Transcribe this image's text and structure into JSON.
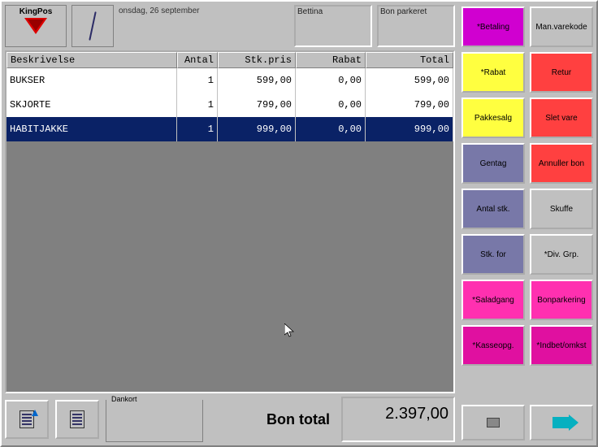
{
  "app_name": "KingPos",
  "date_text": "onsdag, 26 september",
  "info_fields": {
    "user_label": "Bettina",
    "status_label": "Bon parkeret"
  },
  "table": {
    "headers": {
      "desc": "Beskrivelse",
      "qty": "Antal",
      "price": "Stk.pris",
      "rabat": "Rabat",
      "total": "Total"
    },
    "rows": [
      {
        "desc": "BUKSER",
        "qty": "1",
        "price": "599,00",
        "rabat": "0,00",
        "total": "599,00",
        "selected": false
      },
      {
        "desc": "SKJORTE",
        "qty": "1",
        "price": "799,00",
        "rabat": "0,00",
        "total": "799,00",
        "selected": false
      },
      {
        "desc": "HABITJAKKE",
        "qty": "1",
        "price": "999,00",
        "rabat": "0,00",
        "total": "999,00",
        "selected": true
      }
    ]
  },
  "payment_group_label": "Dankort",
  "total_label": "Bon total",
  "total_value": "2.397,00",
  "buttons": {
    "row0": [
      {
        "label": "*Betaling",
        "color": "c-magenta"
      },
      {
        "label": "Man.varekode",
        "color": "c-gray"
      }
    ],
    "row1": [
      {
        "label": "*Rabat",
        "color": "c-yellow"
      },
      {
        "label": "Retur",
        "color": "c-red"
      }
    ],
    "row2": [
      {
        "label": "Pakkesalg",
        "color": "c-yellow"
      },
      {
        "label": "Slet vare",
        "color": "c-red"
      }
    ],
    "row3": [
      {
        "label": "Gentag",
        "color": "c-slate"
      },
      {
        "label": "Annuller bon",
        "color": "c-red"
      }
    ],
    "row4": [
      {
        "label": "Antal stk.",
        "color": "c-slate"
      },
      {
        "label": "Skuffe",
        "color": "c-gray"
      }
    ],
    "row5": [
      {
        "label": "Stk. for",
        "color": "c-slate"
      },
      {
        "label": "*Div. Grp.",
        "color": "c-gray"
      }
    ],
    "row6": [
      {
        "label": "*Saladgang",
        "color": "c-hotpink"
      },
      {
        "label": "Bonparkering",
        "color": "c-hotpink"
      }
    ],
    "row7": [
      {
        "label": "*Kasseopg.",
        "color": "c-deeppink"
      },
      {
        "label": "*Indbet/omkst",
        "color": "c-deeppink"
      }
    ]
  }
}
